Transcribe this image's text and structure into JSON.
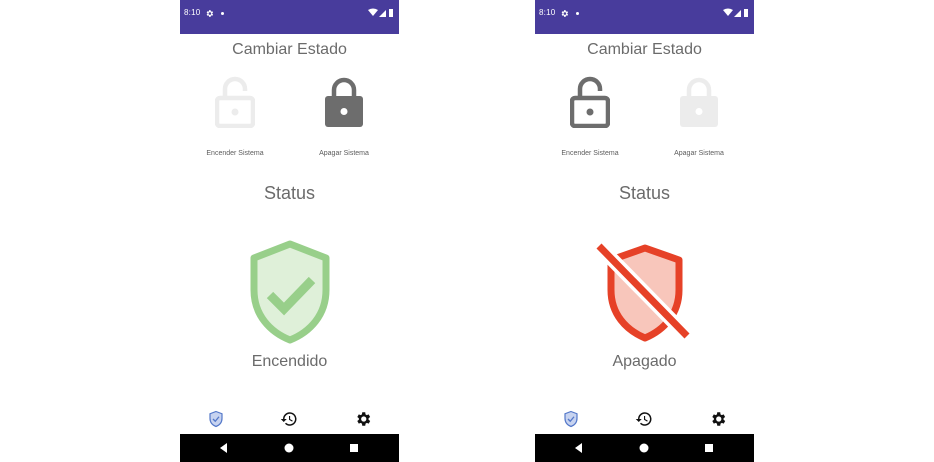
{
  "screens": [
    {
      "status_bar": {
        "time": "8:10"
      },
      "change_title": "Cambiar Estado",
      "locks": {
        "on_label": "Encender Sistema",
        "off_label": "Apagar Sistema"
      },
      "status_title": "Status",
      "state_text": "Encendido",
      "state_icon": "shield-check-icon",
      "colors": {
        "active_icon": "#6d6d6d",
        "inactive_icon": "#ececec",
        "shield_on": "#98cf8a",
        "shield_off": "#e64127"
      },
      "bottom_nav": [
        "shield-icon",
        "history-icon",
        "settings-icon"
      ]
    },
    {
      "status_bar": {
        "time": "8:10"
      },
      "change_title": "Cambiar Estado",
      "locks": {
        "on_label": "Encender Sistema",
        "off_label": "Apagar Sistema"
      },
      "status_title": "Status",
      "state_text": "Apagado",
      "state_icon": "shield-off-icon",
      "colors": {
        "active_icon": "#6d6d6d",
        "inactive_icon": "#ececec",
        "shield_on": "#98cf8a",
        "shield_off": "#e64127"
      },
      "bottom_nav": [
        "shield-icon",
        "history-icon",
        "settings-icon"
      ]
    }
  ]
}
